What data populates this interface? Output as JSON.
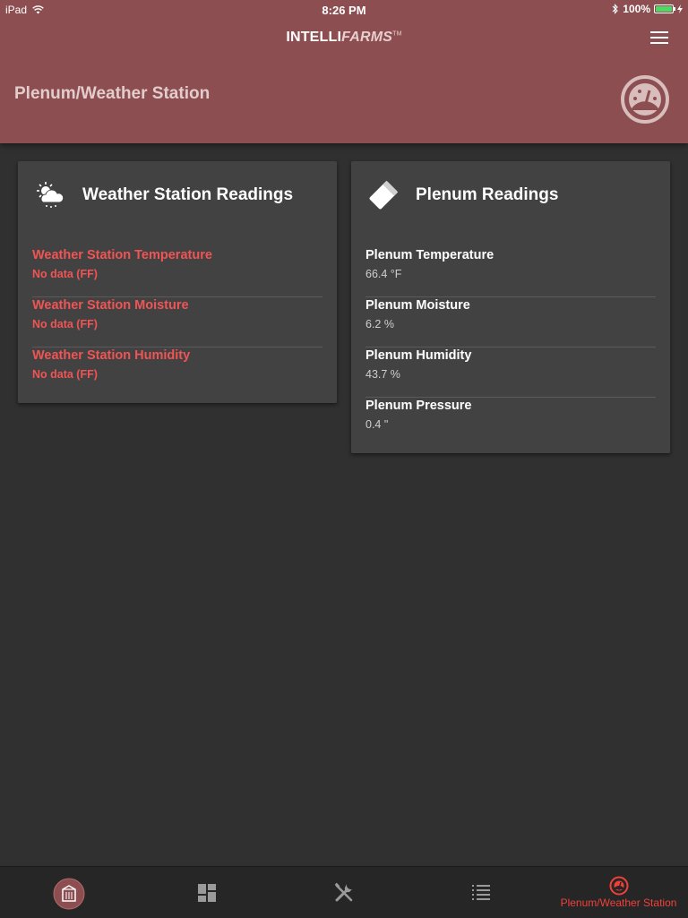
{
  "status_bar": {
    "device": "iPad",
    "time": "8:26 PM",
    "battery": "100%"
  },
  "header": {
    "brand_primary": "INTELLI",
    "brand_secondary": "FARMS",
    "brand_tm": "TM",
    "page_title": "Plenum/Weather Station"
  },
  "weather_card": {
    "title": "Weather Station Readings",
    "rows": [
      {
        "label": "Weather Station Temperature",
        "value": "No data (FF)"
      },
      {
        "label": "Weather Station Moisture",
        "value": "No data (FF)"
      },
      {
        "label": "Weather Station Humidity",
        "value": "No data (FF)"
      }
    ]
  },
  "plenum_card": {
    "title": "Plenum Readings",
    "rows": [
      {
        "label": "Plenum Temperature",
        "value": "66.4 °F"
      },
      {
        "label": "Plenum Moisture",
        "value": "6.2 %"
      },
      {
        "label": "Plenum Humidity",
        "value": "43.7 %"
      },
      {
        "label": "Plenum Pressure",
        "value": "0.4 \""
      }
    ]
  },
  "tabbar": {
    "tabs": [
      {
        "icon": "bin-logo-icon"
      },
      {
        "icon": "dashboard-icon"
      },
      {
        "icon": "tools-icon"
      },
      {
        "icon": "list-icon"
      },
      {
        "icon": "gauge-icon",
        "label": "Plenum/Weather Station",
        "active": true
      }
    ]
  },
  "colors": {
    "header": "#8c4e50",
    "accent_red": "#f05455",
    "background": "#303030",
    "card": "#424242"
  }
}
